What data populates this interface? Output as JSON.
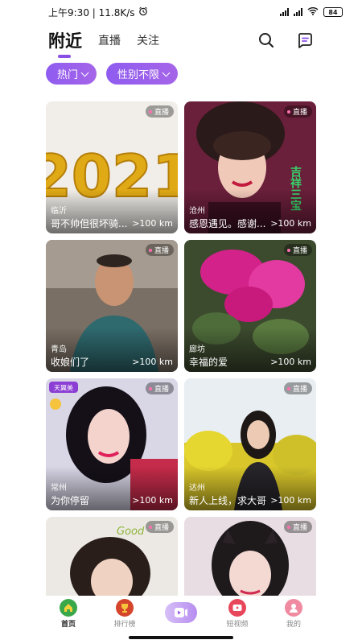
{
  "status_bar": {
    "time": "上午9:30 | 11.8K/s",
    "battery": "84",
    "icons": [
      "alarm-icon",
      "signal-icon",
      "wifi-icon",
      "battery-icon"
    ]
  },
  "header": {
    "tabs": [
      {
        "label": "附近",
        "active": true
      },
      {
        "label": "直播",
        "active": false
      },
      {
        "label": "关注",
        "active": false
      }
    ],
    "icons": [
      "search-icon",
      "message-icon"
    ]
  },
  "filters": [
    {
      "label": "热门"
    },
    {
      "label": "性别不限"
    }
  ],
  "live_label": "直播",
  "cards": [
    {
      "city": "临沂",
      "title": "哥不帅但很坏骑...",
      "distance": ">100 km"
    },
    {
      "city": "沧州",
      "title": "感恩遇见。感谢...",
      "distance": ">100 km"
    },
    {
      "city": "青岛",
      "title": "收娘们了",
      "distance": ">100 km"
    },
    {
      "city": "廊坊",
      "title": "幸福的爱",
      "distance": ">100 km"
    },
    {
      "city": "常州",
      "title": "为你停留",
      "distance": ">100 km"
    },
    {
      "city": "达州",
      "title": "新人上线，求大哥",
      "distance": ">100 km"
    },
    {
      "city": "",
      "title": "",
      "distance": ""
    },
    {
      "city": "",
      "title": "",
      "distance": ""
    }
  ],
  "overlay_texts": {
    "year": "2021",
    "cursive": "吉祥三宝",
    "tag": "天翼美",
    "good": "Good"
  },
  "bottom_nav": [
    {
      "label": "首页",
      "active": true
    },
    {
      "label": "排行榜",
      "active": false
    },
    {
      "label": "",
      "active": false
    },
    {
      "label": "短视频",
      "active": false
    },
    {
      "label": "我的",
      "active": false
    }
  ],
  "colors": {
    "accent": "#8a4fe6",
    "filter_bg": "#9a5fec",
    "live_dot": "#ff6fae"
  }
}
